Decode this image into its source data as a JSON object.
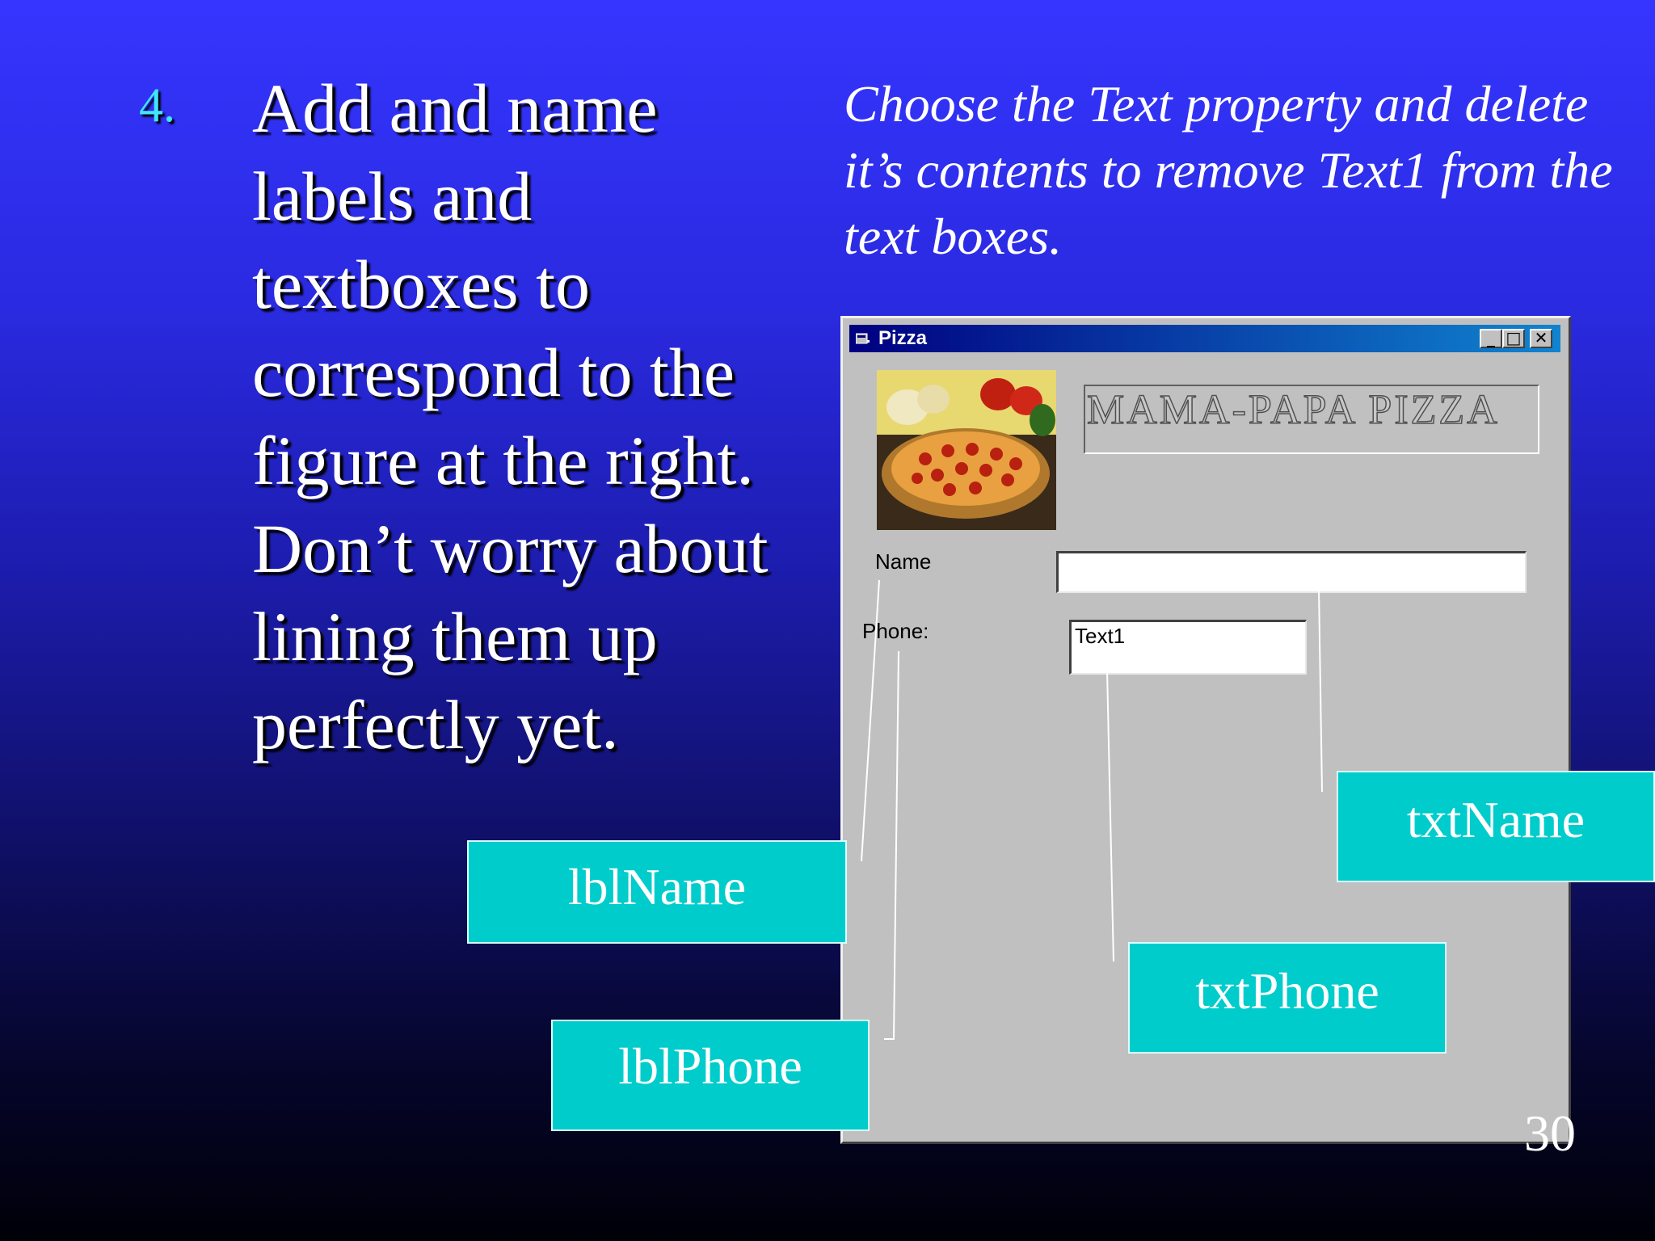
{
  "step": {
    "number": "4.",
    "text": "Add and name labels and textboxes to correspond to the figure at the right.  Don’t worry about lining them up perfectly yet."
  },
  "instruction": "Choose the Text property and delete it’s contents to remove Text1 from the text boxes.",
  "window": {
    "title": "Pizza",
    "minimize_glyph": "_",
    "maximize_glyph": "□",
    "close_glyph": "✕",
    "brand_text": "MAMA-PAPA PIZZA",
    "name_label": "Name",
    "phone_label": "Phone:",
    "name_textbox_value": "",
    "phone_textbox_value": "Text1"
  },
  "callouts": {
    "lbl_name": "lblName",
    "lbl_phone": "lblPhone",
    "txt_name": "txtName",
    "txt_phone": "txtPhone"
  },
  "page_number": "30",
  "colors": {
    "callout_fill": "#00cccc",
    "step_number": "#3fe6ff",
    "title_bar": "#000080"
  }
}
